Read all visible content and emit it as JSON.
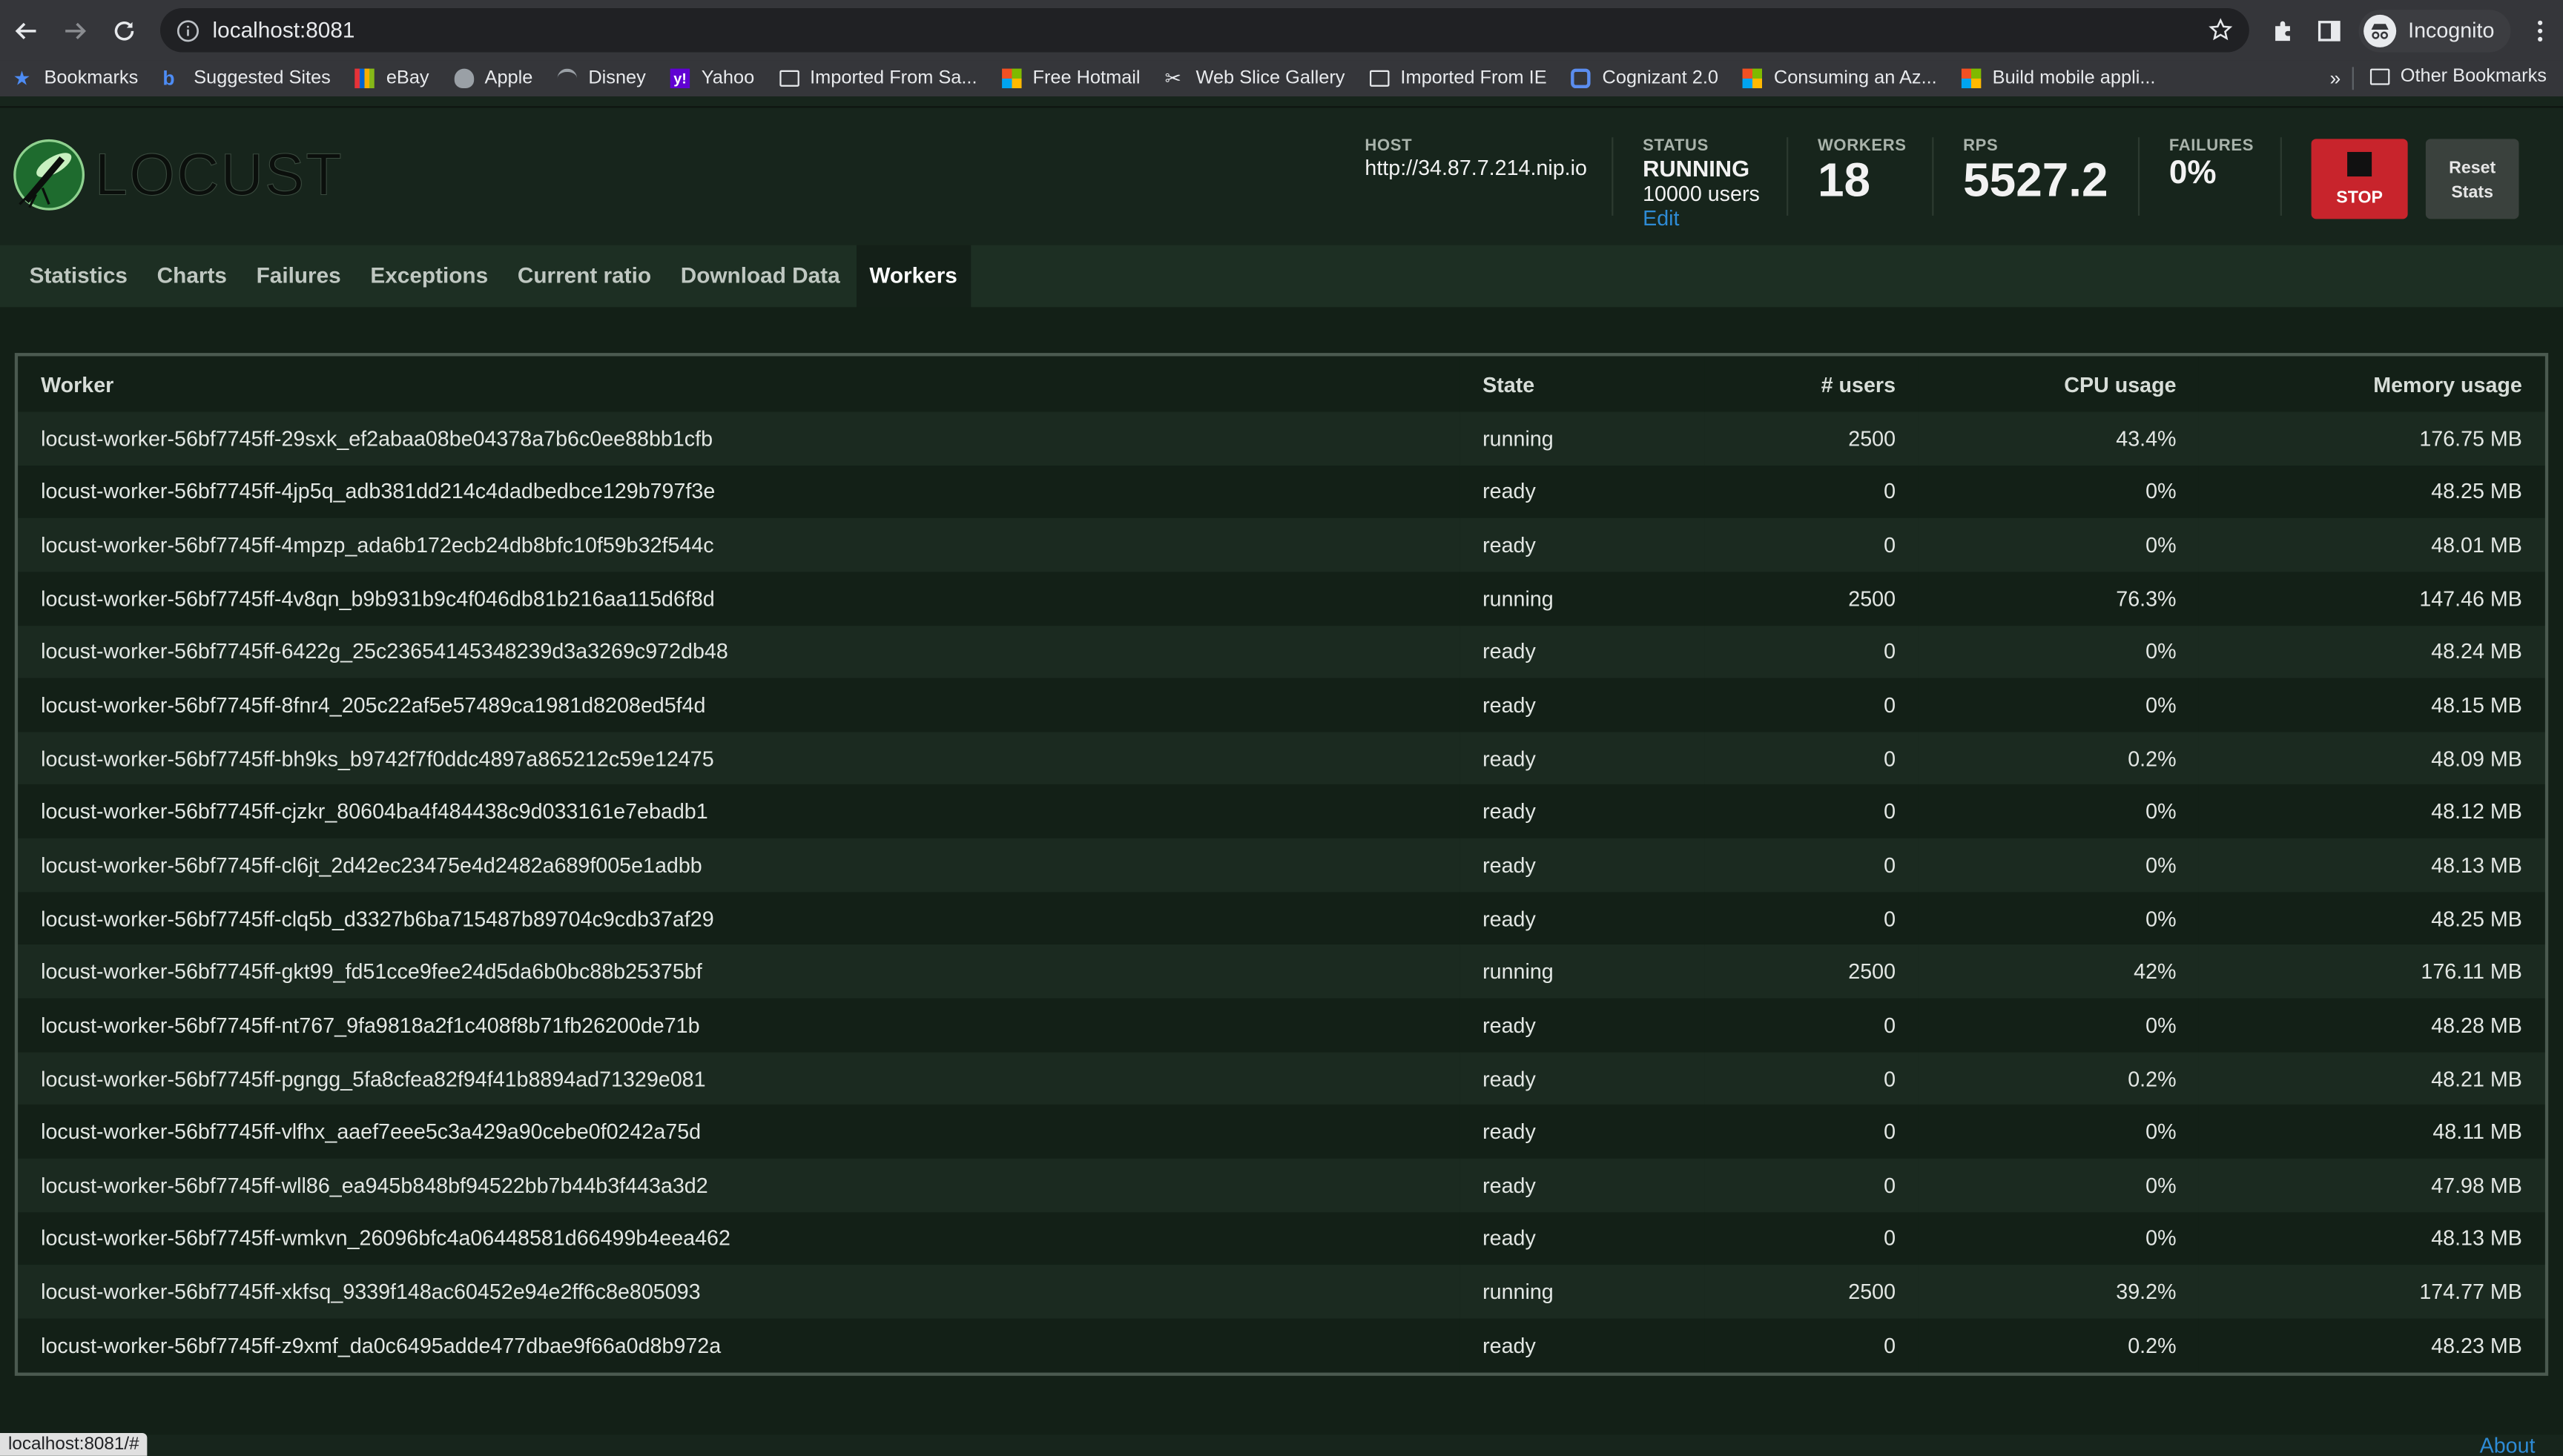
{
  "browser": {
    "url": "localhost:8081",
    "profile": "Incognito",
    "bookmarks": [
      "Bookmarks",
      "Suggested Sites",
      "eBay",
      "Apple",
      "Disney",
      "Yahoo",
      "Imported From Sa...",
      "Free Hotmail",
      "Web Slice Gallery",
      "Imported From IE",
      "Cognizant 2.0",
      "Consuming an Az...",
      "Build mobile appli..."
    ],
    "more": "»",
    "other_bookmarks": "Other Bookmarks",
    "status_url": "localhost:8081/#"
  },
  "header": {
    "logo_text": "LOCUST",
    "host_label": "HOST",
    "host_value": "http://34.87.7.214.nip.io",
    "status_label": "STATUS",
    "status_value": "RUNNING",
    "users": "10000 users",
    "edit": "Edit",
    "workers_label": "WORKERS",
    "workers_value": "18",
    "rps_label": "RPS",
    "rps_value": "5527.2",
    "failures_label": "FAILURES",
    "failures_value": "0%",
    "stop": "STOP",
    "reset_line1": "Reset",
    "reset_line2": "Stats"
  },
  "tabs": [
    "Statistics",
    "Charts",
    "Failures",
    "Exceptions",
    "Current ratio",
    "Download Data",
    "Workers"
  ],
  "table": {
    "headers": [
      "Worker",
      "State",
      "# users",
      "CPU usage",
      "Memory usage"
    ],
    "rows": [
      [
        "locust-worker-56bf7745ff-29sxk_ef2abaa08be04378a7b6c0ee88bb1cfb",
        "running",
        "2500",
        "43.4%",
        "176.75 MB"
      ],
      [
        "locust-worker-56bf7745ff-4jp5q_adb381dd214c4dadbedbce129b797f3e",
        "ready",
        "0",
        "0%",
        "48.25 MB"
      ],
      [
        "locust-worker-56bf7745ff-4mpzp_ada6b172ecb24db8bfc10f59b32f544c",
        "ready",
        "0",
        "0%",
        "48.01 MB"
      ],
      [
        "locust-worker-56bf7745ff-4v8qn_b9b931b9c4f046db81b216aa115d6f8d",
        "running",
        "2500",
        "76.3%",
        "147.46 MB"
      ],
      [
        "locust-worker-56bf7745ff-6422g_25c23654145348239d3a3269c972db48",
        "ready",
        "0",
        "0%",
        "48.24 MB"
      ],
      [
        "locust-worker-56bf7745ff-8fnr4_205c22af5e57489ca1981d8208ed5f4d",
        "ready",
        "0",
        "0%",
        "48.15 MB"
      ],
      [
        "locust-worker-56bf7745ff-bh9ks_b9742f7f0ddc4897a865212c59e12475",
        "ready",
        "0",
        "0.2%",
        "48.09 MB"
      ],
      [
        "locust-worker-56bf7745ff-cjzkr_80604ba4f484438c9d033161e7ebadb1",
        "ready",
        "0",
        "0%",
        "48.12 MB"
      ],
      [
        "locust-worker-56bf7745ff-cl6jt_2d42ec23475e4d2482a689f005e1adbb",
        "ready",
        "0",
        "0%",
        "48.13 MB"
      ],
      [
        "locust-worker-56bf7745ff-clq5b_d3327b6ba715487b89704c9cdb37af29",
        "ready",
        "0",
        "0%",
        "48.25 MB"
      ],
      [
        "locust-worker-56bf7745ff-gkt99_fd51cce9fee24d5da6b0bc88b25375bf",
        "running",
        "2500",
        "42%",
        "176.11 MB"
      ],
      [
        "locust-worker-56bf7745ff-nt767_9fa9818a2f1c408f8b71fb26200de71b",
        "ready",
        "0",
        "0%",
        "48.28 MB"
      ],
      [
        "locust-worker-56bf7745ff-pgngg_5fa8cfea82f94f41b8894ad71329e081",
        "ready",
        "0",
        "0.2%",
        "48.21 MB"
      ],
      [
        "locust-worker-56bf7745ff-vlfhx_aaef7eee5c3a429a90cebe0f0242a75d",
        "ready",
        "0",
        "0%",
        "48.11 MB"
      ],
      [
        "locust-worker-56bf7745ff-wll86_ea945b848bf94522bb7b44b3f443a3d2",
        "ready",
        "0",
        "0%",
        "47.98 MB"
      ],
      [
        "locust-worker-56bf7745ff-wmkvn_26096bfc4a06448581d66499b4eea462",
        "ready",
        "0",
        "0%",
        "48.13 MB"
      ],
      [
        "locust-worker-56bf7745ff-xkfsq_9339f148ac60452e94e2ff6c8e805093",
        "running",
        "2500",
        "39.2%",
        "174.77 MB"
      ],
      [
        "locust-worker-56bf7745ff-z9xmf_da0c6495adde477dbae9f66a0d8b972a",
        "ready",
        "0",
        "0.2%",
        "48.23 MB"
      ]
    ]
  },
  "footer": {
    "about": "About"
  },
  "colors": {
    "stop": "#c8242c",
    "background": "#132017",
    "link": "#2e8bd5"
  }
}
